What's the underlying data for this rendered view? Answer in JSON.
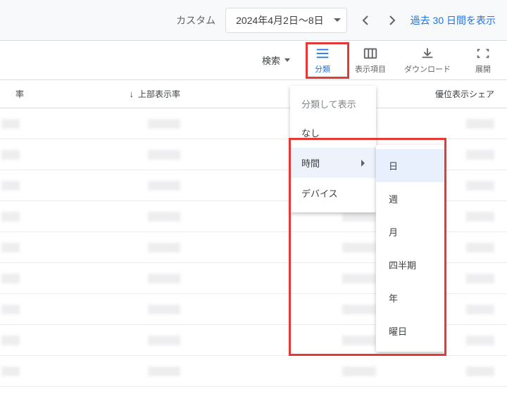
{
  "topbar": {
    "custom_label": "カスタム",
    "date_range": "2024年4月2日～8日",
    "last30_link": "過去 30 日間を表示"
  },
  "toolbar": {
    "search_label": "検索",
    "segment_label": "分類",
    "columns_label": "表示項目",
    "download_label": "ダウンロード",
    "expand_label": "展開"
  },
  "columns": {
    "rate": "率",
    "top_display_rate": "上部表示率",
    "abs_top_share": "優位表示シェア"
  },
  "segment_menu": {
    "title": "分類して表示",
    "none": "なし",
    "time": "時間",
    "device": "デバイス"
  },
  "time_submenu": {
    "day": "日",
    "week": "週",
    "month": "月",
    "quarter": "四半期",
    "year": "年",
    "day_of_week": "曜日"
  }
}
